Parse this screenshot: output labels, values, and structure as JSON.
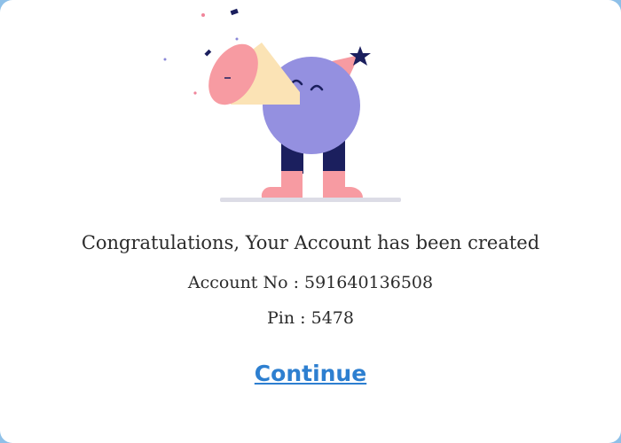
{
  "dialog": {
    "message": "Congratulations, Your Account has been created",
    "account_label": "Account No",
    "account_number": "591640136508",
    "pin_label": "Pin",
    "pin_value": "5478",
    "continue_label": "Continue"
  },
  "colors": {
    "link": "#2d7fd0",
    "character_body": "#9490e0",
    "horn": "#fbe3b5",
    "pink": "#f79ba2",
    "navy": "#1b1f5e"
  },
  "illustration": "party-celebration-character-icon"
}
